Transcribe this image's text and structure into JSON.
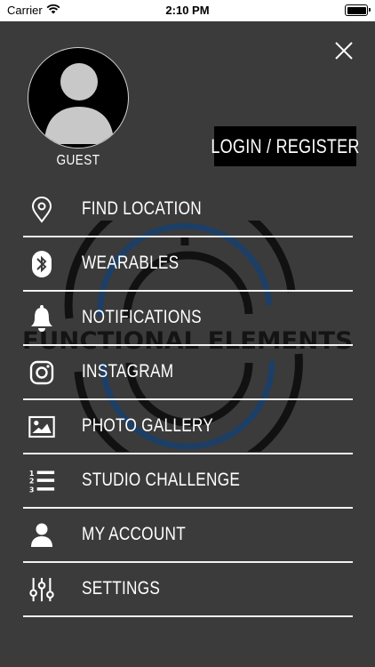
{
  "status_bar": {
    "carrier": "Carrier",
    "time": "2:10 PM"
  },
  "profile": {
    "name": "GUEST",
    "login_label": "LOGIN / REGISTER"
  },
  "watermark": {
    "text": "FUNCTIONAL ELEMENTS"
  },
  "menu": {
    "items": [
      {
        "label": "FIND LOCATION",
        "icon": "location-pin-icon"
      },
      {
        "label": "WEARABLES",
        "icon": "bluetooth-icon"
      },
      {
        "label": "NOTIFICATIONS",
        "icon": "bell-icon"
      },
      {
        "label": "INSTAGRAM",
        "icon": "instagram-icon"
      },
      {
        "label": "PHOTO GALLERY",
        "icon": "image-icon"
      },
      {
        "label": "STUDIO CHALLENGE",
        "icon": "numbered-list-icon"
      },
      {
        "label": "MY ACCOUNT",
        "icon": "user-icon"
      },
      {
        "label": "SETTINGS",
        "icon": "sliders-icon"
      }
    ]
  },
  "colors": {
    "background": "#3b3b3b",
    "button_bg": "#000000",
    "text": "#ffffff",
    "divider": "#f2f2f2",
    "watermark_blue": "#1d3f66"
  }
}
